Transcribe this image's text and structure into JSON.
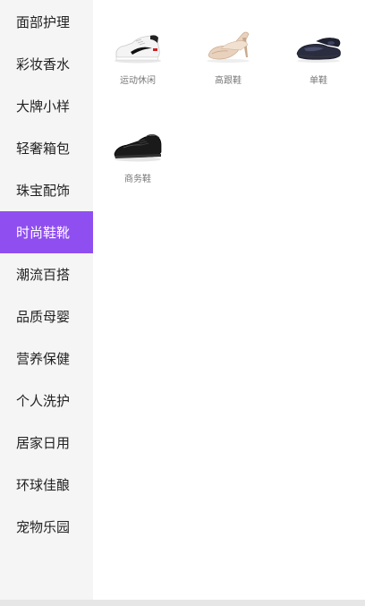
{
  "sidebar": {
    "items": [
      {
        "label": "面部护理"
      },
      {
        "label": "彩妆香水"
      },
      {
        "label": "大牌小样"
      },
      {
        "label": "轻奢箱包"
      },
      {
        "label": "珠宝配饰"
      },
      {
        "label": "时尚鞋靴",
        "active": true
      },
      {
        "label": "潮流百搭"
      },
      {
        "label": "品质母婴"
      },
      {
        "label": "营养保健"
      },
      {
        "label": "个人洗护"
      },
      {
        "label": "居家日用"
      },
      {
        "label": "环球佳酿"
      },
      {
        "label": "宠物乐园"
      }
    ],
    "active_color": "#8f4ff0"
  },
  "content": {
    "categories": [
      {
        "label": "运动休闲",
        "icon": "white-sneaker-icon"
      },
      {
        "label": "高跟鞋",
        "icon": "nude-heel-icon"
      },
      {
        "label": "单鞋",
        "icon": "navy-flat-icon"
      },
      {
        "label": "商务鞋",
        "icon": "black-oxford-icon"
      }
    ]
  }
}
